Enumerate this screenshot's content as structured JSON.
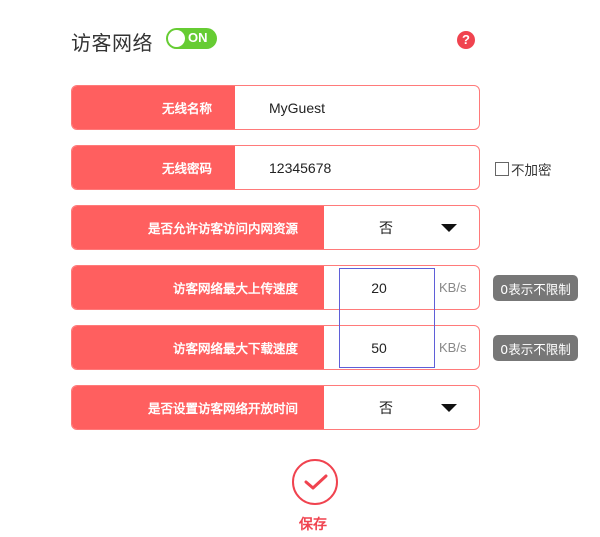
{
  "header": {
    "title": "访客网络",
    "toggle_label": "ON",
    "toggle_state": "on",
    "help_label": "?"
  },
  "form": {
    "ssid": {
      "label": "无线名称",
      "value": "MyGuest"
    },
    "password": {
      "label": "无线密码",
      "value": "12345678",
      "no_encrypt_label": "不加密",
      "no_encrypt_checked": false
    },
    "allow_intranet": {
      "label": "是否允许访客访问内网资源",
      "selected": "否"
    },
    "upload_speed": {
      "label": "访客网络最大上传速度",
      "value": "20",
      "unit": "KB/s",
      "hint": "0表示不限制"
    },
    "download_speed": {
      "label": "访客网络最大下载速度",
      "value": "50",
      "unit": "KB/s",
      "hint": "0表示不限制"
    },
    "open_time": {
      "label": "是否设置访客网络开放时间",
      "selected": "否"
    }
  },
  "actions": {
    "save_label": "保存"
  },
  "colors": {
    "accent": "#ff5f5f",
    "toggle_on": "#66cc33",
    "hint_bg": "#777777",
    "focus_outline": "#5f5fd8"
  }
}
